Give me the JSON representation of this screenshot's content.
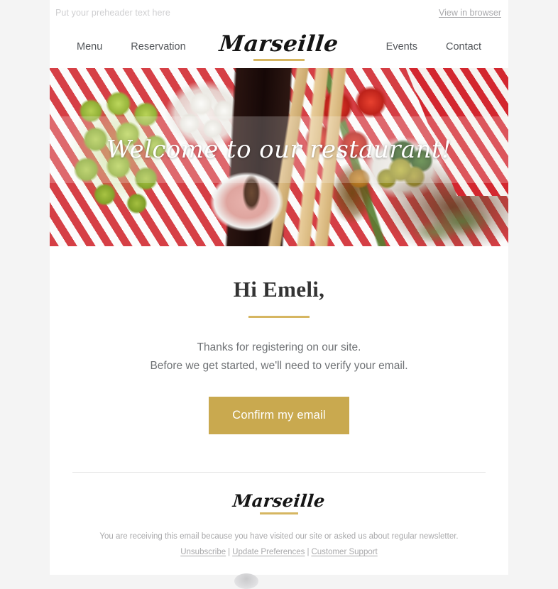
{
  "page": {
    "background_color": "#f4f4f4",
    "card_background": "#ffffff",
    "accent_gold": "#d6b661",
    "cta_gold": "#c9a94f"
  },
  "preheader": {
    "text": "Put your preheader text here",
    "view_in_browser": "View in browser"
  },
  "nav": {
    "left_items": [
      {
        "label": "Menu"
      },
      {
        "label": "Reservation"
      }
    ],
    "right_items": [
      {
        "label": "Events"
      },
      {
        "label": "Contact"
      }
    ],
    "logo": "Marseille"
  },
  "hero": {
    "title": "Welcome to our restaurant!",
    "image_description": "overhead flat-lay of green grapes, mozzarella balls in a glass bowl, red wine bottle, breadsticks, cherry tomatoes on the vine, pink himalayan salt, olive oil jug, green olives with basil, rosemary and a red checkered cloth on a stone surface"
  },
  "body": {
    "greeting": "Hi Emeli,",
    "line1": "Thanks for registering on our site.",
    "line2": "Before we get started, we'll need to verify your email.",
    "cta_label": "Confirm my email"
  },
  "footer": {
    "logo": "Marseille",
    "disclaimer": "You are receiving this email because you have visited our site or asked us about regular newsletter.",
    "links": [
      {
        "label": "Unsubscribe"
      },
      {
        "label": "Update Preferences"
      },
      {
        "label": "Customer Support"
      }
    ],
    "separator": "|"
  }
}
